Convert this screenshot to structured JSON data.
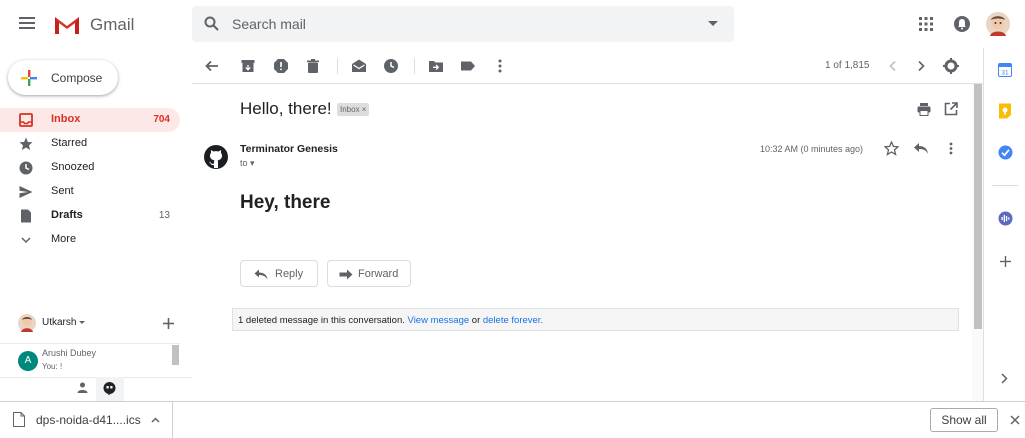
{
  "header": {
    "app_name": "Gmail",
    "search_placeholder": "Search mail"
  },
  "sidebar": {
    "compose_label": "Compose",
    "items": [
      {
        "label": "Inbox",
        "count": "704",
        "icon": "inbox-icon"
      },
      {
        "label": "Starred",
        "count": "",
        "icon": "star-icon"
      },
      {
        "label": "Snoozed",
        "count": "",
        "icon": "clock-icon"
      },
      {
        "label": "Sent",
        "count": "",
        "icon": "send-icon"
      },
      {
        "label": "Drafts",
        "count": "13",
        "icon": "draft-icon"
      },
      {
        "label": "More",
        "count": "",
        "icon": "chevron-down-icon"
      }
    ]
  },
  "hangouts": {
    "user_name": "Utkarsh",
    "contact_name": "Arushi Dubey",
    "contact_initial": "A",
    "contact_snippet": "You: !"
  },
  "toolbar": {
    "pagination": "1 of 1,815"
  },
  "message": {
    "subject": "Hello, there!",
    "label_chip": "Inbox ×",
    "sender": "Terminator Genesis",
    "to_line": "to ▾",
    "time": "10:32 AM (0 minutes ago)",
    "body": "Hey, there",
    "reply_label": "Reply",
    "forward_label": "Forward",
    "deleted_text": "1 deleted message in this conversation.",
    "view_message": "View message",
    "or_text": " or ",
    "delete_forever": "delete forever."
  },
  "download": {
    "file_name": "dps-noida-d41....ics",
    "show_all": "Show all"
  },
  "colors": {
    "gmail_red": "#d93025",
    "link_blue": "#1a73e8",
    "active_bg": "#fce8e6"
  }
}
